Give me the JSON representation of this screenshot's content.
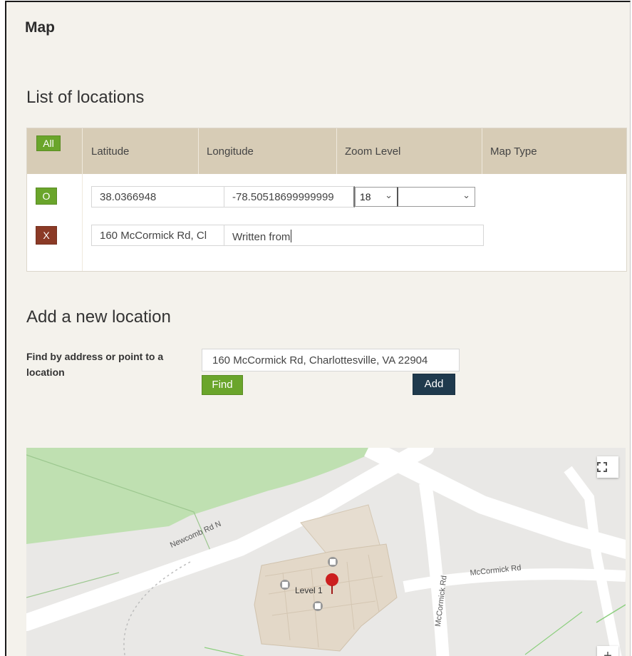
{
  "page": {
    "title": "Map"
  },
  "locations": {
    "heading": "List of locations",
    "all_button": "All",
    "columns": [
      "Latitude",
      "Longitude",
      "Zoom Level",
      "Map Type"
    ],
    "row": {
      "open_button": "O",
      "delete_button": "X",
      "latitude": "38.0366948",
      "longitude": "-78.50518699999999",
      "zoom": "18",
      "map_type": "",
      "address": "160 McCormick Rd, Cl",
      "description": "Written from"
    }
  },
  "add_location": {
    "heading": "Add a new location",
    "find_label": "Find by address or point to a location",
    "address_value": "160 McCormick Rd, Charlottesville, VA 22904",
    "find_button": "Find",
    "add_button": "Add"
  },
  "map": {
    "labels": {
      "road1": "Newcomb Rd N",
      "road2": "McCormick Rd",
      "road3": "McCormick Rd",
      "building": "Level 1"
    },
    "fullscreen_icon": "fullscreen-icon",
    "zoom_in_label": "+",
    "marker_color": "#cc1f1f"
  }
}
